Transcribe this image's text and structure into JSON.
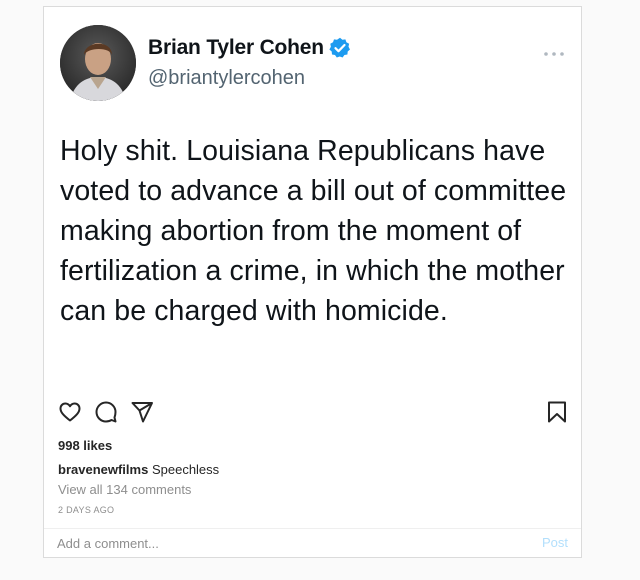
{
  "tweet": {
    "display_name": "Brian Tyler Cohen",
    "handle": "@briantylercohen",
    "verified_color": "#1d9bf0",
    "text": "Holy shit. Louisiana Republicans have voted to advance a bill out of committee making abortion from the moment of fertilization a crime, in which the mother can be charged with homicide."
  },
  "post": {
    "likes": "998 likes",
    "caption_user": "bravenewfilms",
    "caption_text": "Speechless",
    "view_comments": "View all 134 comments",
    "timestamp": "2 DAYS AGO"
  },
  "comment_box": {
    "placeholder": "Add a comment...",
    "post_label": "Post"
  },
  "icons": {
    "more": "more-horizontal-icon",
    "like": "heart-icon",
    "comment": "comment-icon",
    "share": "send-icon",
    "save": "bookmark-icon"
  }
}
